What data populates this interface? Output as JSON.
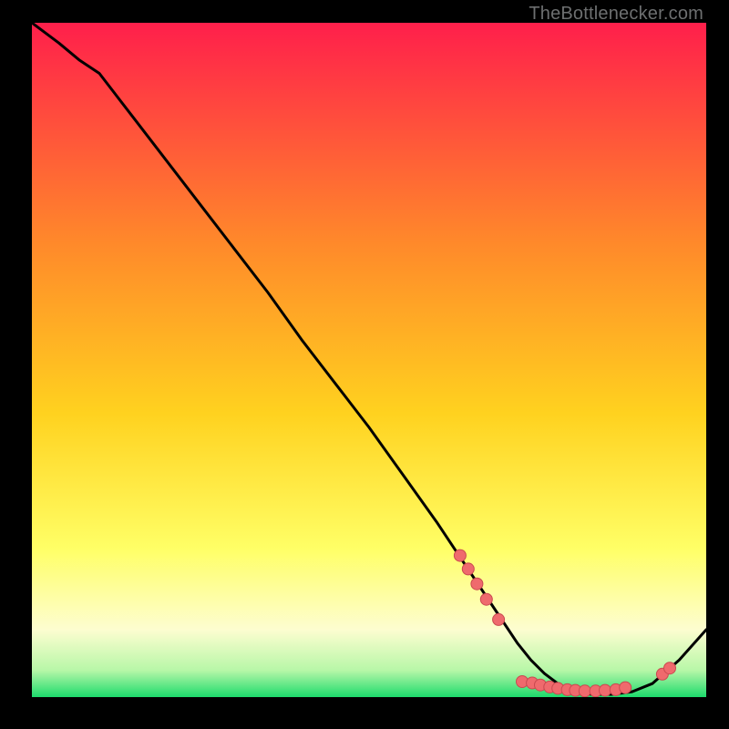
{
  "attribution": "TheBottlenecker.com",
  "colors": {
    "gradient_top": "#ff1f4b",
    "gradient_mid1": "#ff6b2e",
    "gradient_mid2": "#ffd21f",
    "gradient_low1": "#ffff66",
    "gradient_low2": "#fdfdd0",
    "gradient_bottom": "#1ddb6c",
    "curve": "#000000",
    "dot_fill": "#ef6a6d",
    "dot_stroke": "#c94a50"
  },
  "chart_data": {
    "type": "line",
    "title": "",
    "xlabel": "",
    "ylabel": "",
    "xlim": [
      0,
      100
    ],
    "ylim": [
      0,
      100
    ],
    "series": [
      {
        "name": "curve",
        "x": [
          0,
          4,
          7,
          10,
          15,
          20,
          25,
          30,
          35,
          40,
          45,
          50,
          55,
          60,
          63,
          66,
          69,
          72,
          74,
          76,
          78,
          80,
          83,
          86,
          89,
          92,
          96,
          100
        ],
        "y": [
          100,
          97,
          94.5,
          92.5,
          86,
          79.5,
          73,
          66.5,
          60,
          53,
          46.5,
          40,
          33,
          26,
          21.5,
          17,
          12.5,
          8,
          5.5,
          3.5,
          2,
          1,
          0.4,
          0.4,
          0.8,
          2.0,
          5.5,
          10
        ]
      }
    ],
    "dots": [
      {
        "x": 63.5,
        "y": 21.0
      },
      {
        "x": 64.7,
        "y": 19.0
      },
      {
        "x": 66.0,
        "y": 16.8
      },
      {
        "x": 67.4,
        "y": 14.5
      },
      {
        "x": 69.2,
        "y": 11.5
      },
      {
        "x": 72.7,
        "y": 2.3
      },
      {
        "x": 74.2,
        "y": 2.1
      },
      {
        "x": 75.4,
        "y": 1.8
      },
      {
        "x": 76.8,
        "y": 1.5
      },
      {
        "x": 78.0,
        "y": 1.3
      },
      {
        "x": 79.4,
        "y": 1.1
      },
      {
        "x": 80.6,
        "y": 1.0
      },
      {
        "x": 82.0,
        "y": 0.9
      },
      {
        "x": 83.6,
        "y": 0.9
      },
      {
        "x": 85.0,
        "y": 1.0
      },
      {
        "x": 86.6,
        "y": 1.1
      },
      {
        "x": 88.0,
        "y": 1.4
      },
      {
        "x": 93.5,
        "y": 3.4
      },
      {
        "x": 94.6,
        "y": 4.3
      }
    ]
  }
}
